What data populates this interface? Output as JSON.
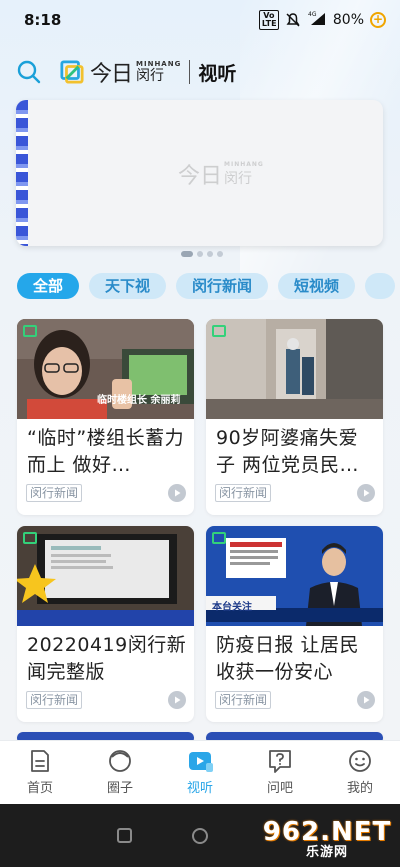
{
  "status_bar": {
    "time": "8:18",
    "volte": "Vo LTE",
    "network": "4G",
    "battery": "80%"
  },
  "header": {
    "logo_cn": "今日",
    "logo_en": "MINHANG",
    "logo_place": "闵行",
    "title": "视听"
  },
  "banner": {
    "watermark_cn": "今日",
    "watermark_en": "MINHANG",
    "watermark_place": "闵行",
    "page_count": 4,
    "active_page": 1
  },
  "tabs": [
    {
      "label": "全部",
      "active": true
    },
    {
      "label": "天下视",
      "active": false
    },
    {
      "label": "闵行新闻",
      "active": false
    },
    {
      "label": "短视频",
      "active": false
    }
  ],
  "cards": [
    {
      "title": "“临时”楼组长蓄力而上 做好…",
      "source": "闵行新闻",
      "thumb_caption": "临时楼组长 余丽莉"
    },
    {
      "title": "90岁阿婆痛失爱子 两位党员民…",
      "source": "闵行新闻",
      "thumb_caption": ""
    },
    {
      "title": "20220419闵行新闻完整版",
      "source": "闵行新闻",
      "thumb_caption": ""
    },
    {
      "title": "防疫日报 让居民收获一份安心",
      "source": "闵行新闻",
      "thumb_caption": "本台关注"
    }
  ],
  "bottom_nav": [
    {
      "label": "首页",
      "icon": "home-doc-icon",
      "active": false
    },
    {
      "label": "圈子",
      "icon": "circle-smile-icon",
      "active": false
    },
    {
      "label": "视听",
      "icon": "video-play-icon",
      "active": true
    },
    {
      "label": "问吧",
      "icon": "question-bubble-icon",
      "active": false
    },
    {
      "label": "我的",
      "icon": "face-icon",
      "active": false
    }
  ],
  "watermark": {
    "main": "962.NET",
    "sub": "乐游网"
  },
  "colors": {
    "accent": "#25a7ea",
    "tab_inactive_bg": "#cfe8f8",
    "tab_inactive_text": "#2a8bc9"
  }
}
